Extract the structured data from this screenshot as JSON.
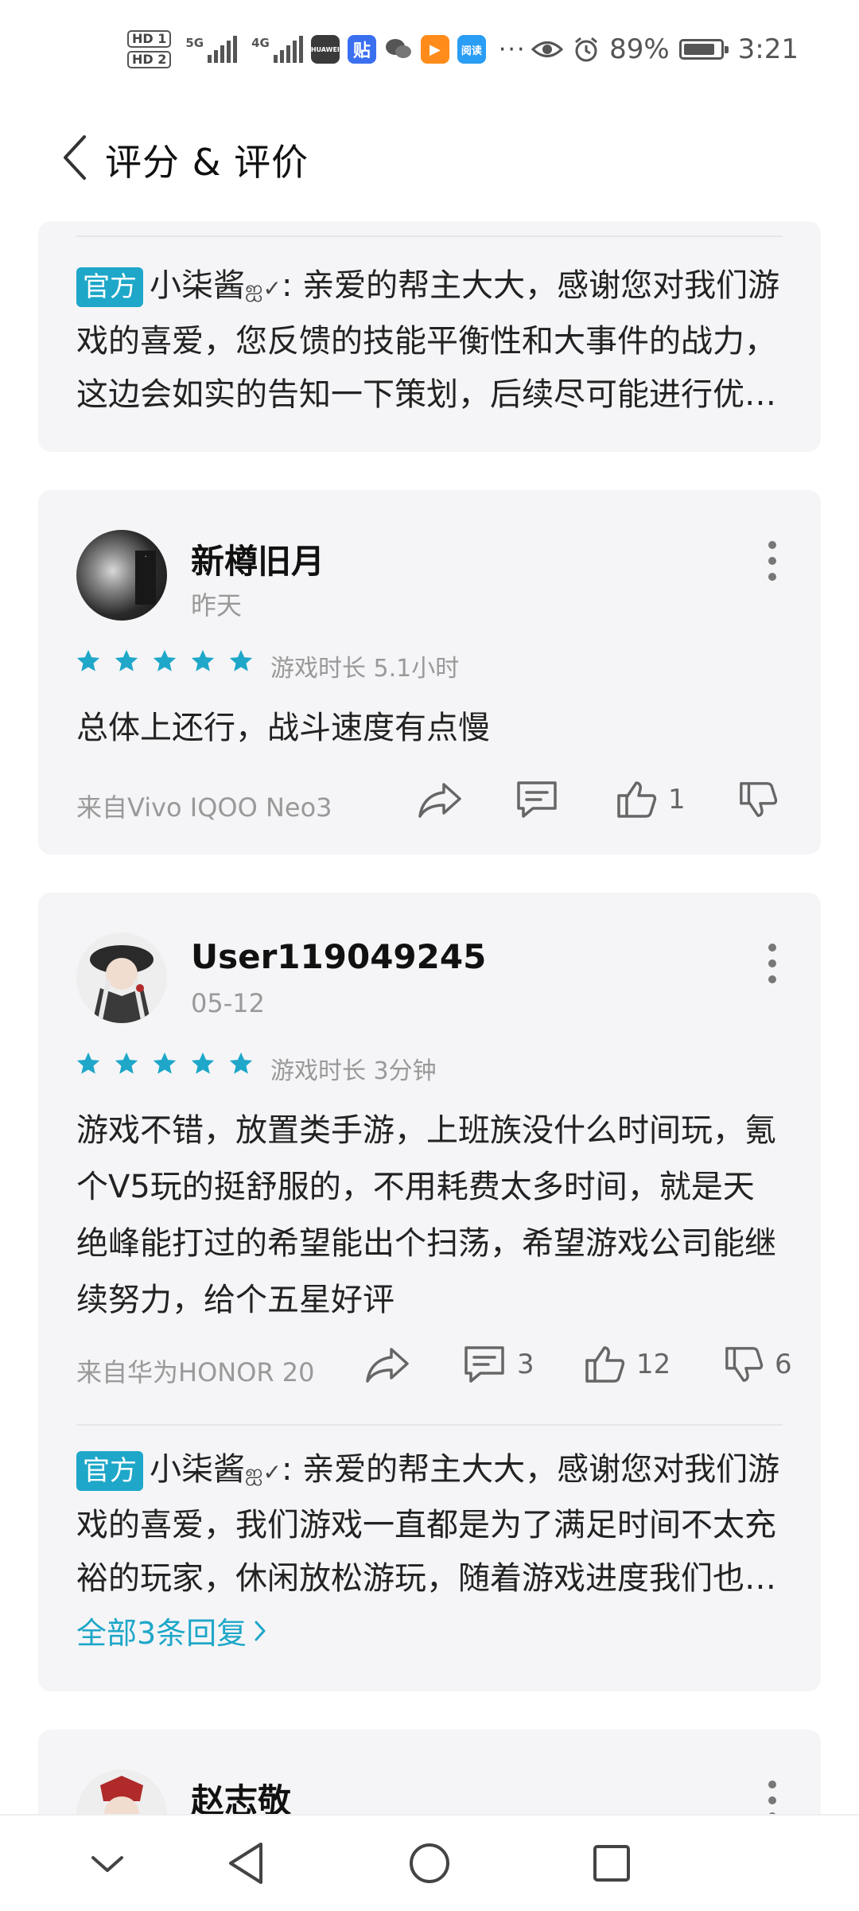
{
  "status_bar": {
    "hd1": "HD 1",
    "hd2": "HD 2",
    "net1": "5G",
    "net2": "4G",
    "apps": [
      {
        "name": "huawei-app-icon",
        "label": "HUAWEI",
        "color": "#3a3a3a"
      },
      {
        "name": "tieba-app-icon",
        "label": "贴",
        "color": "#3a6ff0"
      },
      {
        "name": "wechat-icon",
        "label": "",
        "color": "#555555"
      },
      {
        "name": "video-app-icon",
        "label": "▶",
        "color": "#ff8c1a"
      },
      {
        "name": "reader-app-icon",
        "label": "阅读",
        "color": "#2a9df4"
      }
    ],
    "more": "···",
    "battery": "89%",
    "time": "3:21"
  },
  "header": {
    "title": "评分 & 评价"
  },
  "official_tag": "官方",
  "card1": {
    "reply_author": "小柒酱",
    "reply_text": "亲爱的帮主大大，感谢您对我们游戏的喜爱，您反馈的技能平衡性和大事件的战力，这边会如实的告知一下策划，后续尽可能进行优化调整，感谢支持"
  },
  "card2": {
    "username": "新樽旧月",
    "date": "昨天",
    "rating": 5,
    "playtime": "游戏时长 5.1小时",
    "text": "总体上还行，战斗速度有点慢",
    "source": "来自Vivo IQOO Neo3",
    "likes": "1"
  },
  "card3": {
    "username": "User119049245",
    "date": "05-12",
    "rating": 5,
    "playtime": "游戏时长 3分钟",
    "text": "游戏不错，放置类手游，上班族没什么时间玩，氪个V5玩的挺舒服的，不用耗费太多时间，就是天绝峰能打过的希望能出个扫荡，希望游戏公司能继续努力，给个五星好评",
    "source": "来自华为HONOR 20",
    "comments": "3",
    "likes": "12",
    "dislikes": "6",
    "reply_author": "小柒酱",
    "reply_text": "亲爱的帮主大大，感谢您对我们游戏的喜爱，我们游戏一直都是为了满足时间不太充裕的玩家，休闲放松游玩，随着游戏进度我们也会不断优化",
    "all_replies": "全部3条回复"
  },
  "card4": {
    "username": "赵志敬"
  },
  "colors": {
    "accent": "#1ea7c9",
    "card_bg": "#f5f5f7"
  }
}
